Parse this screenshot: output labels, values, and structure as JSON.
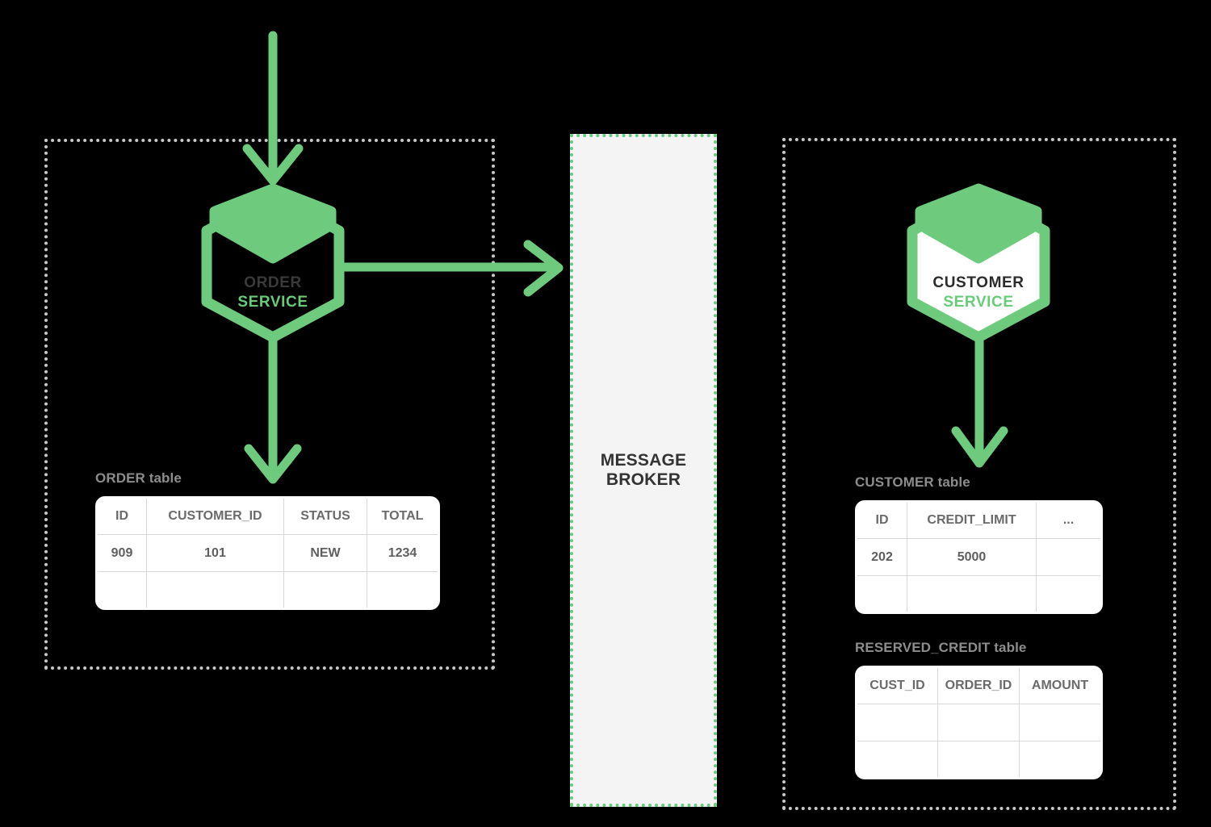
{
  "diagram": {
    "title": "Order Service / Customer Service messaging via Message Broker",
    "background": "#000000",
    "accent_green": "#6ecb7e",
    "dotted_gray": "#c8c8c8"
  },
  "message_broker": {
    "label_line1": "MESSAGE",
    "label_line2": "BROKER",
    "fill": "#f4f4f4",
    "border_color": "#67cc7f"
  },
  "services": {
    "order": {
      "name_line1": "ORDER",
      "name_line2": "SERVICE",
      "hex_fill": "none",
      "hex_stroke": "#6ecb7e"
    },
    "customer": {
      "name_line1": "CUSTOMER",
      "name_line2": "SERVICE",
      "hex_fill": "#ffffff",
      "hex_stroke": "#6ecb7e"
    }
  },
  "tables": {
    "order": {
      "caption": "ORDER table",
      "columns": [
        "ID",
        "CUSTOMER_ID",
        "STATUS",
        "TOTAL"
      ],
      "rows": [
        [
          "909",
          "101",
          "NEW",
          "1234"
        ],
        [
          "",
          "",
          "",
          ""
        ]
      ]
    },
    "customer": {
      "caption": "CUSTOMER table",
      "columns": [
        "ID",
        "CREDIT_LIMIT",
        "..."
      ],
      "rows": [
        [
          "202",
          "5000",
          ""
        ],
        [
          "",
          "",
          ""
        ]
      ]
    },
    "reserved_credit": {
      "caption": "RESERVED_CREDIT table",
      "columns": [
        "CUST_ID",
        "ORDER_ID",
        "AMOUNT"
      ],
      "rows": [
        [
          "",
          "",
          ""
        ],
        [
          "",
          "",
          ""
        ]
      ]
    }
  },
  "arrows": [
    {
      "name": "inbound-to-order-service",
      "direction": "down"
    },
    {
      "name": "order-service-to-order-table",
      "direction": "down"
    },
    {
      "name": "order-service-to-message-broker",
      "direction": "right"
    },
    {
      "name": "customer-service-to-customer-table",
      "direction": "down"
    }
  ]
}
